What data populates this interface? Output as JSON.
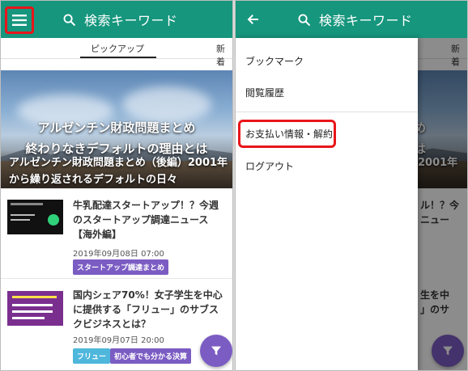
{
  "search": {
    "placeholder": "検索キーワード"
  },
  "tabs": {
    "pickup": "ピックアップ",
    "new": "新着"
  },
  "hero": {
    "headline1": "アルゼンチン財政問題まとめ",
    "headline2": "終わりなきデフォルトの理由とは",
    "caption_line1": "アルゼンチン財政問題まとめ（後編）2001年",
    "caption_line2": "から繰り返されるデフォルトの日々"
  },
  "articles": [
    {
      "title": "牛乳配達スタートアップ！？今週のスタートアップ調達ニュース【海外編】",
      "date": "2019年09月08日 07:00",
      "tags": [
        "スタートアップ調達まとめ"
      ]
    },
    {
      "title": "国内シェア70%！女子学生を中心に提供する「フリュー」のサブスクビジネスとは？",
      "date": "2019年09月07日 20:00",
      "tags": [
        "フリュー",
        "初心者でも分かる決算"
      ]
    }
  ],
  "drawer": {
    "items": [
      "ブックマーク",
      "閲覧履歴",
      "お支払い情報・解約",
      "ログアウト"
    ]
  },
  "colors": {
    "appbar": "#16967d",
    "highlight": "#e8151a",
    "tag": "#7b5cc3",
    "tag_light": "#4fb7dc",
    "fab": "#7b5cc3"
  },
  "icons": {
    "menu": "hamburger-menu-icon",
    "search": "search-icon",
    "back": "back-arrow-icon",
    "filter": "filter-icon"
  }
}
